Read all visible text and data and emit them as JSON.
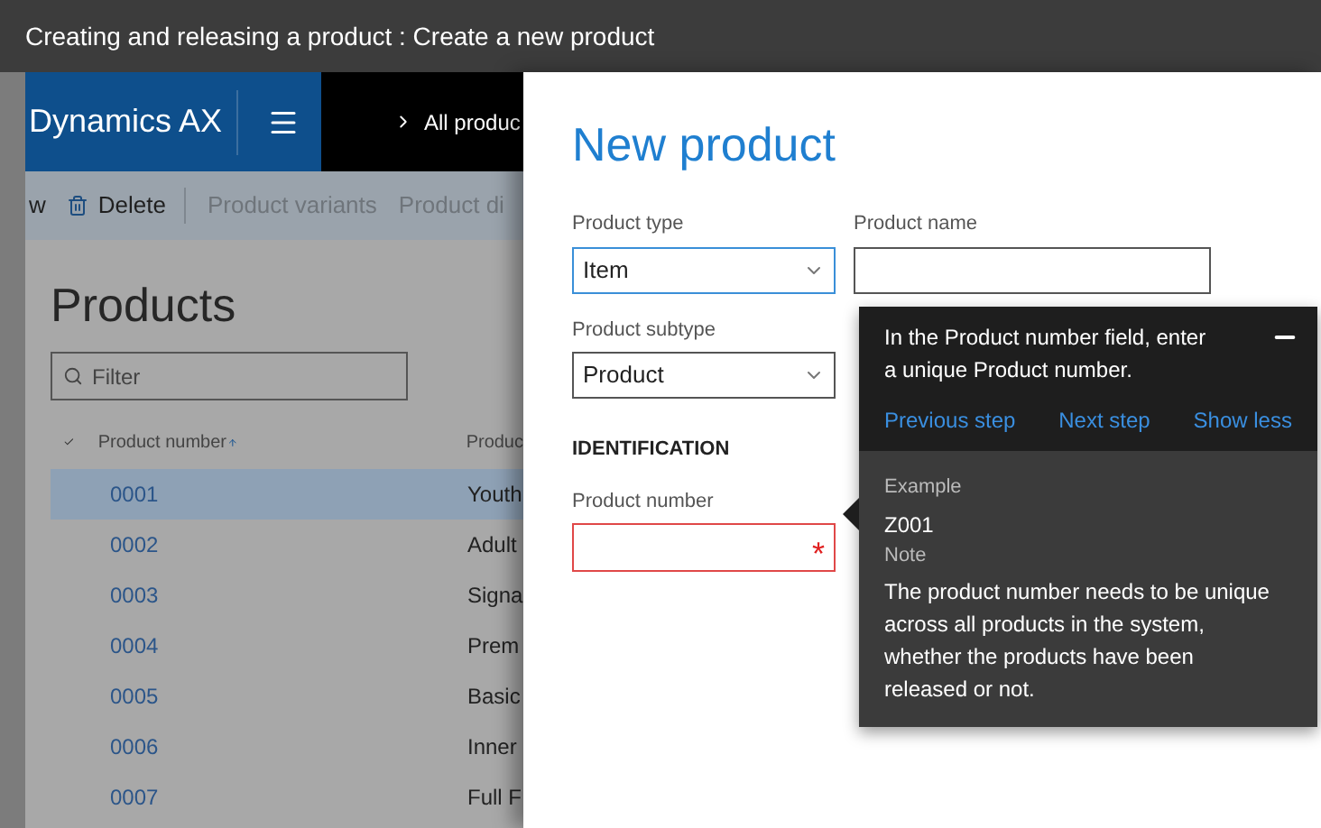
{
  "window": {
    "title": "Creating and releasing a product : Create a new product"
  },
  "app": {
    "brand": "Dynamics AX",
    "breadcrumb": "All produc",
    "toolbar": [
      {
        "kind": "text",
        "label": "w",
        "disabled": false
      },
      {
        "kind": "delete",
        "label": "Delete",
        "disabled": false
      },
      {
        "kind": "text",
        "label": "Product variants",
        "disabled": true
      },
      {
        "kind": "text",
        "label": "Product di",
        "disabled": true
      }
    ],
    "page_title": "Products",
    "filter": {
      "placeholder": "Filter"
    },
    "columns": [
      "Product number",
      "Produc"
    ],
    "rows": [
      {
        "number": "0001",
        "name": "Youth",
        "selected": true
      },
      {
        "number": "0002",
        "name": "Adult",
        "selected": false
      },
      {
        "number": "0003",
        "name": "Signa",
        "selected": false
      },
      {
        "number": "0004",
        "name": "Prem",
        "selected": false
      },
      {
        "number": "0005",
        "name": "Basic",
        "selected": false
      },
      {
        "number": "0006",
        "name": "Inner",
        "selected": false
      },
      {
        "number": "0007",
        "name": "Full F",
        "selected": false
      }
    ]
  },
  "dialog": {
    "title": "New product",
    "product_type": {
      "label": "Product type",
      "value": "Item",
      "focused": true
    },
    "product_name": {
      "label": "Product name"
    },
    "product_subtype": {
      "label": "Product subtype",
      "value": "Product",
      "focused": false
    },
    "section": "IDENTIFICATION",
    "product_number": {
      "label": "Product number",
      "required": true,
      "required_mark": "*"
    }
  },
  "tooltip": {
    "text": "In the Product number field, enter a unique Product number.",
    "links": [
      "Previous step",
      "Next step",
      "Show less"
    ],
    "example_label": "Example",
    "example": "Z001",
    "note_label": "Note",
    "note": "The product number needs to be unique across all products in the system, whether the products have been released or not."
  }
}
